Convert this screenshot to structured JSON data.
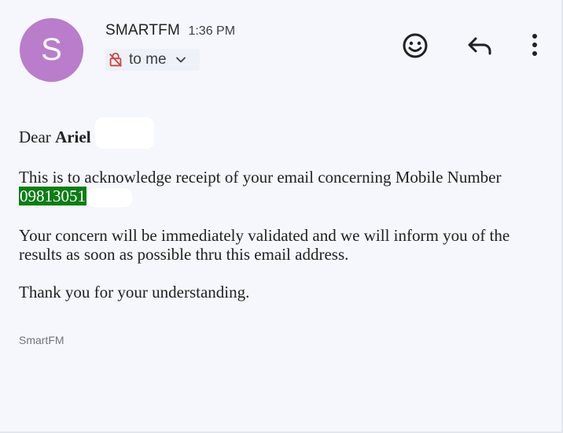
{
  "sender": {
    "avatar_letter": "S",
    "name": "SMARTFM",
    "time": "1:36 PM",
    "recipient": "to me",
    "avatar_color": "#b97dcb"
  },
  "actions": {
    "emoji_icon": "smiley-face-icon",
    "reply_icon": "reply-arrow-icon",
    "more_icon": "vertical-dots-icon"
  },
  "message": {
    "greeting_prefix": "Dear ",
    "greeting_name": "Ariel",
    "ack_text": "This is to acknowledge receipt of your email concerning Mobile Number",
    "mobile_number": "09813051",
    "concern_text": "Your concern will be immediately validated and we will inform you of the results as soon as possible thru this email address.",
    "thanks_text": "Thank you for your understanding."
  },
  "signature": "SmartFM",
  "colors": {
    "highlight": "#0a7e12",
    "background": "#f5f7fc"
  }
}
